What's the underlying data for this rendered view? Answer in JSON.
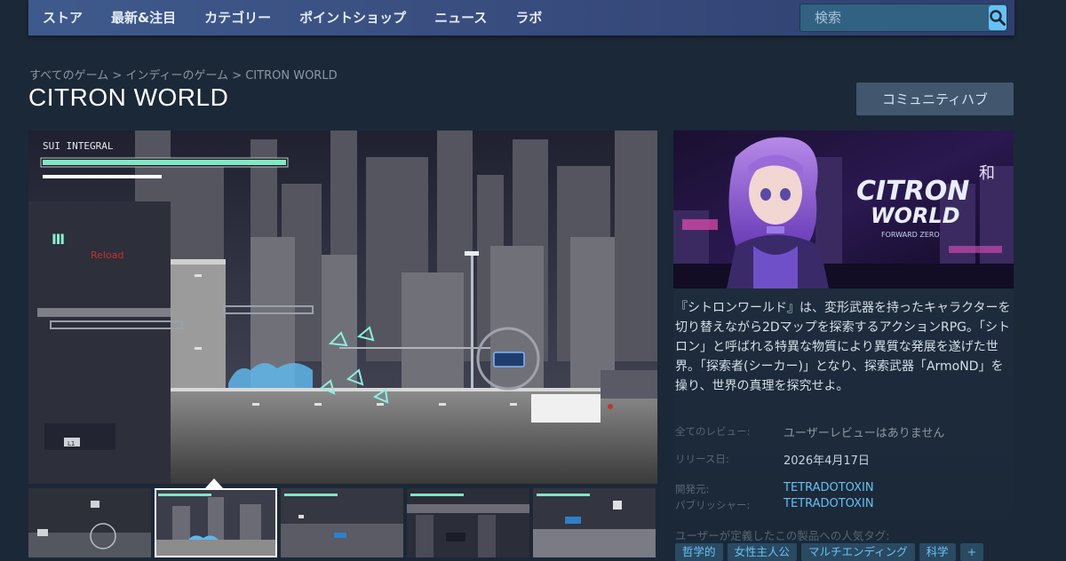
{
  "nav": {
    "items": [
      "ストア",
      "最新&注目",
      "カテゴリー",
      "ポイントショップ",
      "ニュース",
      "ラボ"
    ],
    "search_placeholder": "検索",
    "search_icon": "magnifier-icon"
  },
  "breadcrumb": {
    "items": [
      "すべてのゲーム",
      "インディーのゲーム",
      "CITRON WORLD"
    ],
    "separator": " > "
  },
  "page": {
    "title": "CITRON WORLD",
    "community_hub_label": "コミュニティハブ"
  },
  "screenshot": {
    "hud_name": "SUI INTEGRAL",
    "hud_reload": "Reload",
    "hud_ammo": "Ⅲ",
    "hud_tag": "L1",
    "thumbnail_count": 5,
    "active_thumbnail": 1
  },
  "capsule": {
    "logo_line1": "CITRON",
    "logo_line2": "WORLD",
    "logo_sub": "FORWARD ZERO",
    "kanji": "和"
  },
  "description": "『シトロンワールド』は、変形武器を持ったキャラクターを切り替えながら2Dマップを探索するアクションRPG。「シトロン」と呼ばれる特異な物質により異質な発展を遂げた世界。「探索者(シーカー)」となり、探索武器「ArmoND」を操り、世界の真理を探究せよ。",
  "info": {
    "reviews_label": "全てのレビュー:",
    "reviews_value": "ユーザーレビューはありません",
    "release_label": "リリース日:",
    "release_value": "2026年4月17日",
    "developer_label": "開発元:",
    "developer_value": "TETRADOTOXIN",
    "publisher_label": "パブリッシャー:",
    "publisher_value": "TETRADOTOXIN"
  },
  "tags": {
    "label": "ユーザーが定義したこの製品への人気タグ:",
    "items": [
      "哲学的",
      "女性主人公",
      "マルチエンディング",
      "科学",
      "+"
    ]
  },
  "colors": {
    "nav_bg": "#3a4f80",
    "page_bg": "#1b2838",
    "link": "#66c0f4",
    "tag_bg": "#2a4a62"
  }
}
